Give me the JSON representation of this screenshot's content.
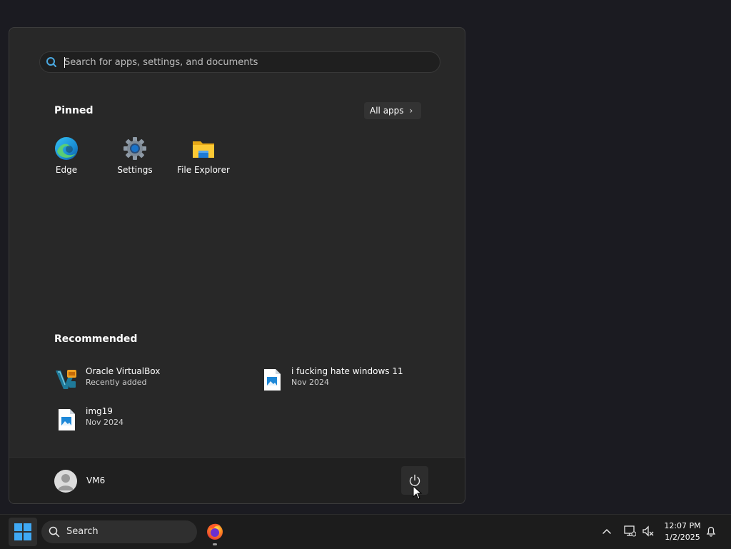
{
  "start_menu": {
    "search": {
      "placeholder": "Search for apps, settings, and documents",
      "value": ""
    },
    "pinned": {
      "title": "Pinned",
      "all_apps_label": "All apps",
      "apps": [
        {
          "label": "Edge",
          "icon": "edge-icon"
        },
        {
          "label": "Settings",
          "icon": "gear-icon"
        },
        {
          "label": "File Explorer",
          "icon": "folder-icon"
        }
      ]
    },
    "recommended": {
      "title": "Recommended",
      "items": [
        {
          "name": "Oracle VirtualBox",
          "sub": "Recently added",
          "icon": "virtualbox-icon"
        },
        {
          "name": "i fucking hate windows 11",
          "sub": "Nov 2024",
          "icon": "image-file-icon"
        },
        {
          "name": "img19",
          "sub": "Nov 2024",
          "icon": "image-file-icon"
        }
      ]
    },
    "user": {
      "name": "VM6"
    }
  },
  "taskbar": {
    "search_label": "Search",
    "clock": {
      "time": "12:07 PM",
      "date": "1/2/2025"
    }
  },
  "colors": {
    "accent": "#0a84d0",
    "menu_bg": "#282828",
    "taskbar_bg": "#1c1c1c",
    "desktop_bg": "#1b1b21"
  }
}
